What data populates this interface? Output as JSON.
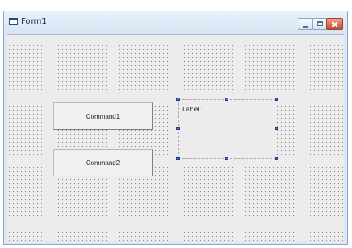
{
  "window": {
    "title": "Form1",
    "icons": {
      "app": "form-icon",
      "minimize": "minimize-icon",
      "maximize": "maximize-icon",
      "close": "close-icon"
    },
    "colors": {
      "frame": "#dfe9f5",
      "close": "#c8452f"
    }
  },
  "form": {
    "buttons": [
      {
        "label": "Command1"
      },
      {
        "label": "Command2"
      }
    ],
    "label": {
      "text": "Label1",
      "selected": true
    }
  }
}
